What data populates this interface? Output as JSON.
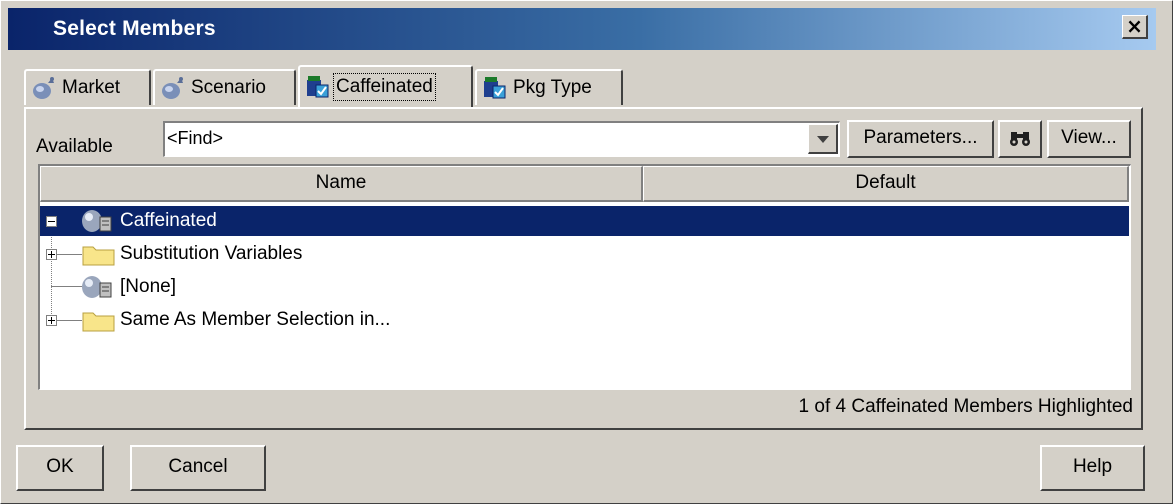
{
  "window": {
    "title": "Select Members",
    "close_label": "×"
  },
  "tabs": [
    {
      "label": "Market",
      "icon": "dimension-icon",
      "active": false
    },
    {
      "label": "Scenario",
      "icon": "dimension-icon",
      "active": false
    },
    {
      "label": "Caffeinated",
      "icon": "attribute-dimension-icon",
      "active": true
    },
    {
      "label": "Pkg Type",
      "icon": "attribute-dimension-icon",
      "active": false
    }
  ],
  "toolbar": {
    "available_label": "Available",
    "find_value": "<Find>",
    "parameters_label": "Parameters...",
    "find_icon": "binoculars-icon",
    "view_label": "View..."
  },
  "table": {
    "columns": [
      "Name",
      "Default"
    ],
    "rows": [
      {
        "label": "Caffeinated",
        "icon": "member-icon",
        "selected": true,
        "expander": "minus"
      },
      {
        "label": "Substitution Variables",
        "icon": "folder-icon",
        "selected": false,
        "expander": "plus"
      },
      {
        "label": "[None]",
        "icon": "member-icon",
        "selected": false,
        "expander": "none"
      },
      {
        "label": "Same As Member Selection in...",
        "icon": "folder-icon",
        "selected": false,
        "expander": "plus"
      }
    ]
  },
  "status": "1 of 4 Caffeinated Members Highlighted",
  "buttons": {
    "ok": "OK",
    "cancel": "Cancel",
    "help": "Help"
  },
  "colors": {
    "title_start": "#0a246a",
    "title_end": "#a6caf0",
    "selection": "#0a246a",
    "face": "#d4d0c8"
  }
}
